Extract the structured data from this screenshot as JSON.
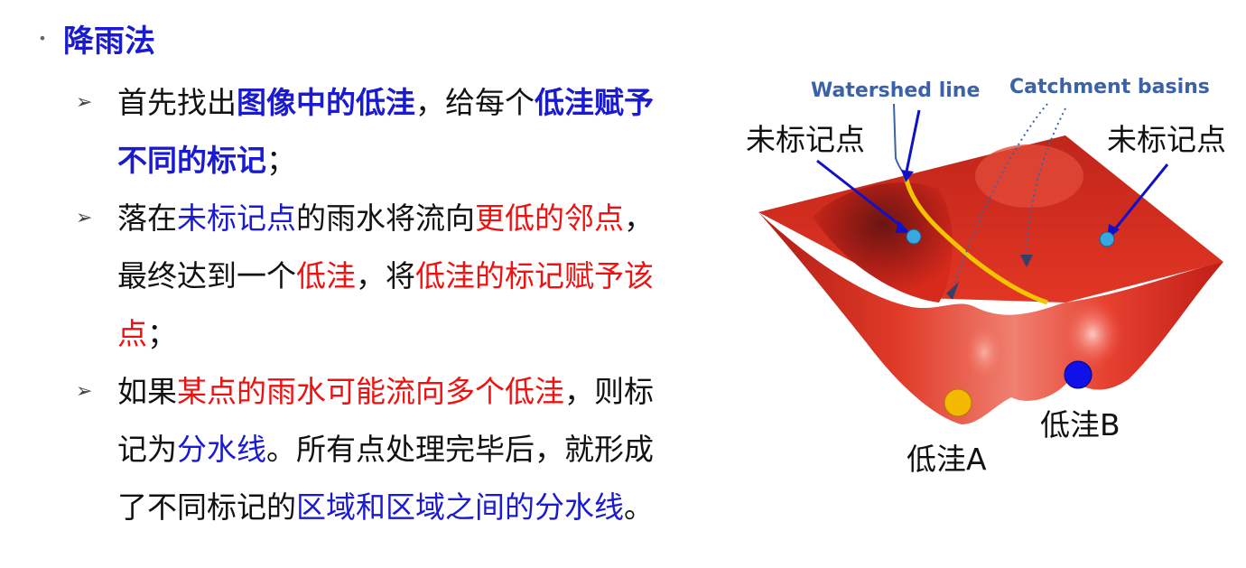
{
  "heading": "降雨法",
  "bullets": [
    {
      "lines": [
        [
          {
            "t": "首先找出",
            "c": ""
          },
          {
            "t": "图像中的低洼",
            "c": "blue bold"
          },
          {
            "t": "，给每个",
            "c": ""
          },
          {
            "t": "低洼赋予",
            "c": "blue bold"
          }
        ],
        [
          {
            "t": "不同的标记",
            "c": "blue bold"
          },
          {
            "t": "；",
            "c": ""
          }
        ]
      ]
    },
    {
      "lines": [
        [
          {
            "t": "落在",
            "c": ""
          },
          {
            "t": "未标记点",
            "c": "blue"
          },
          {
            "t": "的雨水将流向",
            "c": ""
          },
          {
            "t": "更低的邻点",
            "c": "red"
          },
          {
            "t": "，",
            "c": ""
          }
        ],
        [
          {
            "t": "最终达到一个",
            "c": ""
          },
          {
            "t": "低洼",
            "c": "red"
          },
          {
            "t": "，将",
            "c": ""
          },
          {
            "t": "低洼的标记赋予该",
            "c": "red"
          }
        ],
        [
          {
            "t": "点",
            "c": "red"
          },
          {
            "t": "；",
            "c": ""
          }
        ]
      ]
    },
    {
      "lines": [
        [
          {
            "t": "如果",
            "c": ""
          },
          {
            "t": "某点的雨水可能流向多个低洼",
            "c": "red"
          },
          {
            "t": "，则标",
            "c": ""
          }
        ],
        [
          {
            "t": "记为",
            "c": ""
          },
          {
            "t": "分水线",
            "c": "blue"
          },
          {
            "t": "。所有点处理完毕后，就形成",
            "c": ""
          }
        ],
        [
          {
            "t": "了不同标记的",
            "c": ""
          },
          {
            "t": "区域和区域之间的分水线",
            "c": "blue"
          },
          {
            "t": "。",
            "c": ""
          }
        ]
      ]
    }
  ],
  "bullet_symbol": "➢",
  "dot_symbol": "•",
  "diagram": {
    "watershed_label": "Watershed line",
    "catchment_label": "Catchment basins",
    "unmarked_left": "未标记点",
    "unmarked_right": "未标记点",
    "basin_a": "低洼A",
    "basin_b": "低洼B"
  },
  "colors": {
    "heading_blue": "#1a1ad0",
    "highlight_red": "#ee1111",
    "surface_red": "#d8281c",
    "watershed_yellow": "#f5c400",
    "basin_a_color": "#f5b800",
    "basin_b_color": "#1010e8",
    "point_cyan": "#3aa8e0"
  }
}
